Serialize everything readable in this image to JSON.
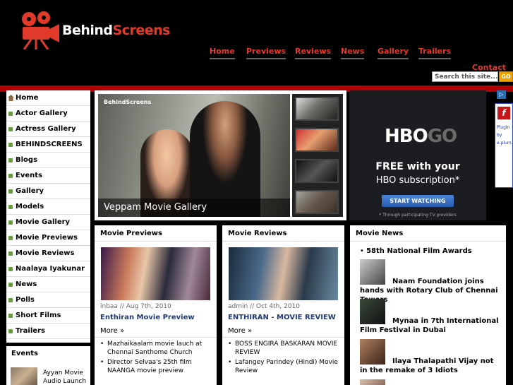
{
  "brand": {
    "part1": "Behind",
    "part2": "Screens"
  },
  "nav": {
    "items": [
      "Home",
      "Previews",
      "Reviews",
      "News",
      "Gallery",
      "Trailers"
    ],
    "contact": "Contact"
  },
  "search": {
    "placeholder": "Search this site...",
    "button": "GO"
  },
  "sidebar": {
    "items": [
      "Home",
      "Actor Gallery",
      "Actress Gallery",
      "BEHINDSCREENS",
      "Blogs",
      "Events",
      "Gallery",
      "Models",
      "Movie Gallery",
      "Movie Previews",
      "Movie Reviews",
      "Naalaya Iyakunar",
      "News",
      "Polls",
      "Short Films",
      "Trailers"
    ]
  },
  "events": {
    "title": "Events",
    "item": "Ayyan Movie Audio Launch"
  },
  "featured": {
    "logo": "BehindScreens",
    "caption": "Veppam Movie Gallery"
  },
  "ad": {
    "hbo": "HBO",
    "go": "GO",
    "line1": "FREE with your",
    "line2": "HBO subscription*",
    "button": "START WATCHING",
    "fine": "* Through participating TV providers",
    "plugin": "Plugin by e.plum."
  },
  "previews": {
    "title": "Movie Previews",
    "meta": "inbaa // Aug 7th, 2010",
    "headline": "Enthiran Movie Preview",
    "more": "More »",
    "links": [
      "Mazhaikaalam movie lauch at Chennai Santhome Church",
      "Director Selvaa's 25th film NAANGA movie preview"
    ]
  },
  "reviews": {
    "title": "Movie Reviews",
    "meta": "admin // Oct 4th, 2010",
    "headline": "ENTHIRAN - MOVIE REVIEW",
    "more": "More »",
    "links": [
      "BOSS ENGIRA BASKARAN MOVIE REVIEW",
      "Lafangey Parindey (Hindi) Movie Review"
    ]
  },
  "news": {
    "title": "Movie News",
    "items": [
      "58th National Film Awards",
      "Naam Foundation joins hands with Rotary Club of Chennai Towers",
      "Mynaa in 7th International Film Festival in Dubai",
      "Ilaya Thalapathi Vijay not in the remake of 3 Idiots"
    ]
  },
  "colors": {
    "accent": "#e23a2a",
    "redbar": "#b20000",
    "link": "#1e3a7a"
  }
}
